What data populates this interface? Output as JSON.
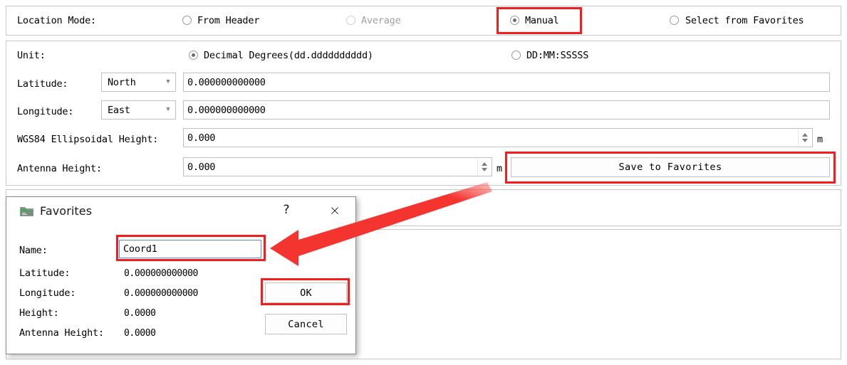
{
  "location_mode": {
    "label": "Location Mode:",
    "options": [
      {
        "label": "From Header",
        "selected": false,
        "disabled": false
      },
      {
        "label": "Average",
        "selected": false,
        "disabled": true
      },
      {
        "label": "Manual",
        "selected": true,
        "disabled": false
      },
      {
        "label": "Select from Favorites",
        "selected": false,
        "disabled": false
      }
    ]
  },
  "coordinates": {
    "unit_label": "Unit:",
    "unit_options": [
      {
        "label": "Decimal Degrees(dd.dddddddddd)",
        "selected": true
      },
      {
        "label": "DD:MM:SSSSS",
        "selected": false
      }
    ],
    "latitude_label": "Latitude:",
    "latitude_hemisphere": "North",
    "latitude_value": "0.000000000000",
    "longitude_label": "Longitude:",
    "longitude_hemisphere": "East",
    "longitude_value": "0.000000000000",
    "ellipsoidal_height_label": "WGS84 Ellipsoidal Height:",
    "ellipsoidal_height_value": "0.000",
    "ellipsoidal_height_unit": "m",
    "antenna_height_label": "Antenna Height:",
    "antenna_height_value": "0.000",
    "antenna_height_unit": "m",
    "save_to_favorites_label": "Save to Favorites"
  },
  "dialog": {
    "title": "Favorites",
    "help_glyph": "?",
    "close_glyph": "×",
    "name_label": "Name:",
    "name_value": "Coord1",
    "latitude_label": "Latitude:",
    "latitude_value": "0.000000000000",
    "longitude_label": "Longitude:",
    "longitude_value": "0.000000000000",
    "height_label": "Height:",
    "height_value": "0.0000",
    "antenna_height_label": "Antenna Height:",
    "antenna_height_value": "0.0000",
    "ok_label": "OK",
    "cancel_label": "Cancel"
  },
  "annotations": {
    "highlight_color": "#f41c1c",
    "arrow_color": "#f4352f"
  }
}
